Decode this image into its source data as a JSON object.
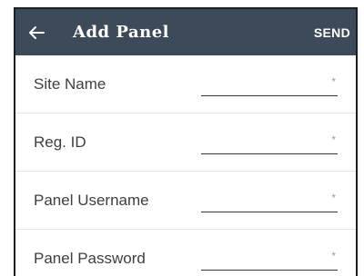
{
  "appbar": {
    "title": "Add Panel",
    "action_label": "SEND",
    "background": "#3c4a5a",
    "back_icon": "arrow-left-icon"
  },
  "form": {
    "fields": [
      {
        "label": "Site Name",
        "value": "",
        "required_mark": "*"
      },
      {
        "label": "Reg. ID",
        "value": "",
        "required_mark": "*"
      },
      {
        "label": "Panel Username",
        "value": "",
        "required_mark": "*"
      },
      {
        "label": "Panel Password",
        "value": "",
        "required_mark": "*"
      }
    ]
  }
}
